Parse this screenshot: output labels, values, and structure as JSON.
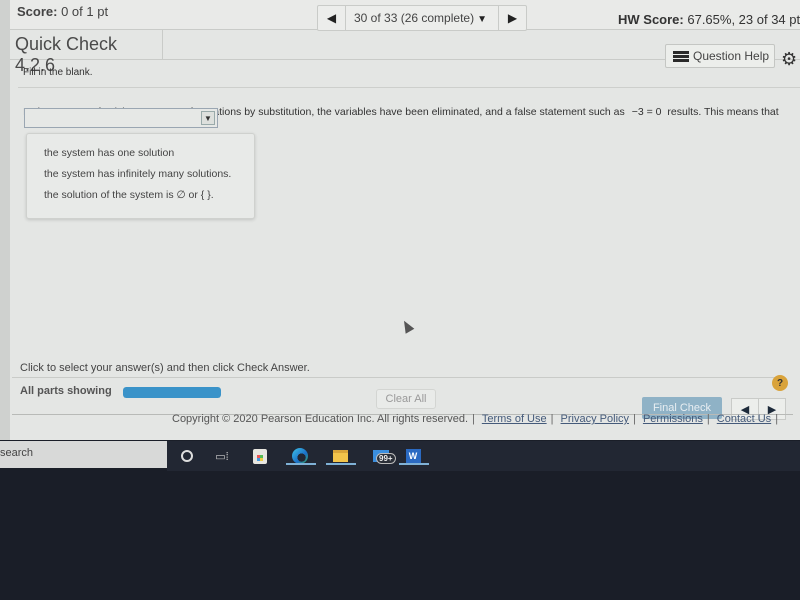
{
  "header": {
    "score_label": "Score:",
    "score_value": "0 of 1 pt",
    "question_nav": {
      "position": "30 of 33 (26 complete)",
      "prev_icon": "triangle-left-icon",
      "next_icon": "triangle-right-icon",
      "caret_icon": "caret-down-icon"
    },
    "hw_score_label": "HW Score:",
    "hw_score_value": "67.65%, 23 of 34 pts"
  },
  "title": "Quick Check 4.2.6",
  "question_help_label": "Question Help",
  "instruction_top": "Fill in the blank.",
  "question": {
    "text": "In the process of solving a system of equations by substitution, the variables have been eliminated, and a false statement such as",
    "equation": "−3 = 0",
    "text_after": "results. This means that",
    "answer_select": {
      "value": "",
      "options": [
        "the system has one solution",
        "the system has infinitely many solutions.",
        "the solution of the system is ∅ or { }."
      ]
    }
  },
  "instruction_bottom": "Click to select your answer(s) and then click Check Answer.",
  "parts": {
    "label": "All parts showing",
    "progress_percent": 100
  },
  "buttons": {
    "clear_all": "Clear All",
    "final_check": "Final Check",
    "help": "?"
  },
  "footer": {
    "copyright": "Copyright © 2020 Pearson Education Inc. All rights reserved.",
    "links": [
      "Terms of Use",
      "Privacy Policy",
      "Permissions",
      "Contact Us"
    ]
  },
  "taskbar": {
    "search_placeholder": "search",
    "mail_badge": "99+",
    "word_letter": "W",
    "apps": [
      "cortana",
      "task-view",
      "microsoft-store",
      "edge",
      "file-explorer",
      "mail",
      "word"
    ]
  },
  "colors": {
    "progress": "#3a93c9",
    "final_check": "#8fb2c6",
    "help_badge": "#d9a33b",
    "taskbar": "#222733"
  }
}
